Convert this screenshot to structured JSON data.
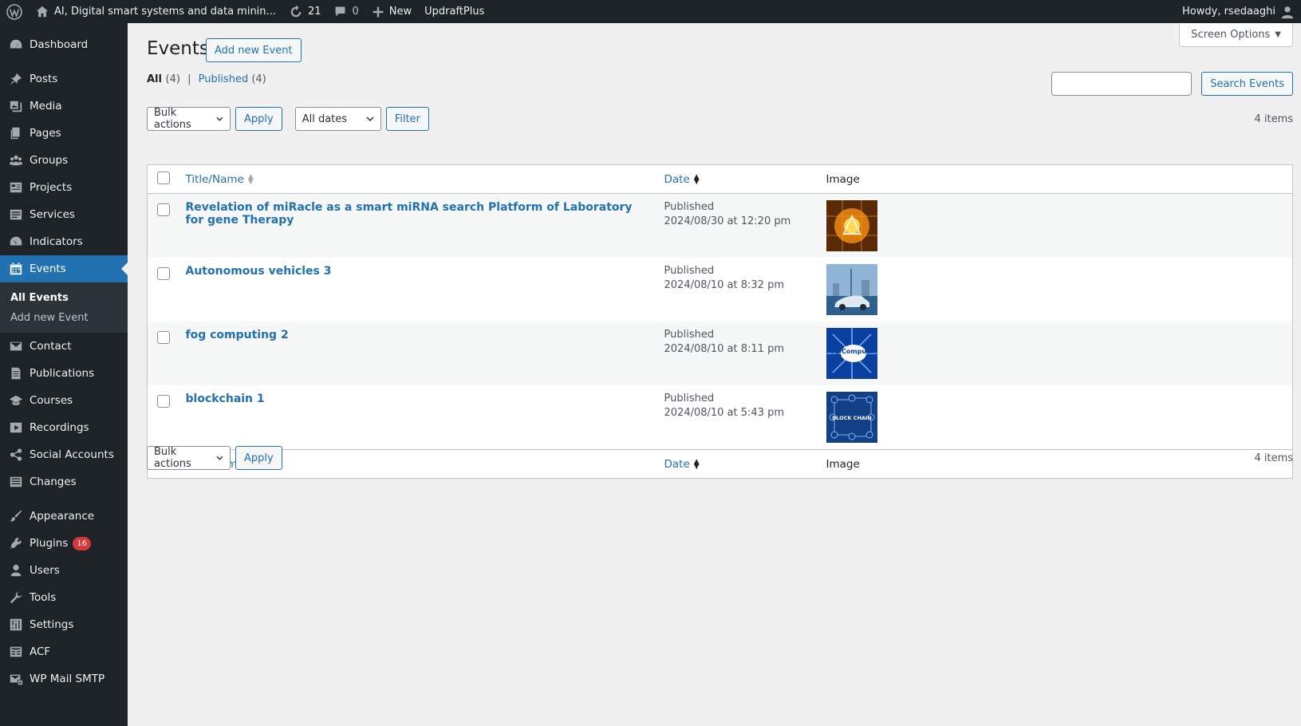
{
  "adminbar": {
    "site_name": "AI, Digital smart systems and data minin...",
    "updates_count": "21",
    "comments_count": "0",
    "new_label": "New",
    "plugin_label": "UpdraftPlus",
    "howdy": "Howdy, rsedaaghi"
  },
  "sidebar": {
    "dashboard": "Dashboard",
    "posts": "Posts",
    "media": "Media",
    "pages": "Pages",
    "groups": "Groups",
    "projects": "Projects",
    "services": "Services",
    "indicators": "Indicators",
    "events": "Events",
    "events_sub": [
      "All Events",
      "Add new Event"
    ],
    "contact": "Contact",
    "publications": "Publications",
    "courses": "Courses",
    "recordings": "Recordings",
    "social_accounts": "Social Accounts",
    "changes": "Changes",
    "appearance": "Appearance",
    "plugins": "Plugins",
    "plugins_badge": "16",
    "users": "Users",
    "tools": "Tools",
    "settings": "Settings",
    "acf": "ACF",
    "wp_mail_smtp": "WP Mail SMTP"
  },
  "main": {
    "screen_options": "Screen Options",
    "page_title": "Events",
    "add_new": "Add new Event",
    "filter_all": "All",
    "filter_all_count": "(4)",
    "filter_published": "Published",
    "filter_published_count": "(4)",
    "search_button": "Search Events",
    "bulk_actions": "Bulk actions",
    "apply": "Apply",
    "all_dates": "All dates",
    "filter": "Filter",
    "items_count": "4 items",
    "columns": {
      "title": "Title/Name",
      "date": "Date",
      "image": "Image"
    },
    "rows": [
      {
        "title": "Revelation of miRacle as a smart miRNA search Platform of Laboratory for gene Therapy",
        "status": "Published",
        "date": "2024/08/30 at 12:20 pm"
      },
      {
        "title": "Autonomous vehicles 3",
        "status": "Published",
        "date": "2024/08/10 at 8:32 pm"
      },
      {
        "title": "fog computing 2",
        "status": "Published",
        "date": "2024/08/10 at 8:11 pm"
      },
      {
        "title": "blockchain 1",
        "status": "Published",
        "date": "2024/08/10 at 5:43 pm"
      }
    ],
    "thumb_texts": {
      "fog": "Fog Computing",
      "block": "BLOCK CHAIN"
    }
  }
}
